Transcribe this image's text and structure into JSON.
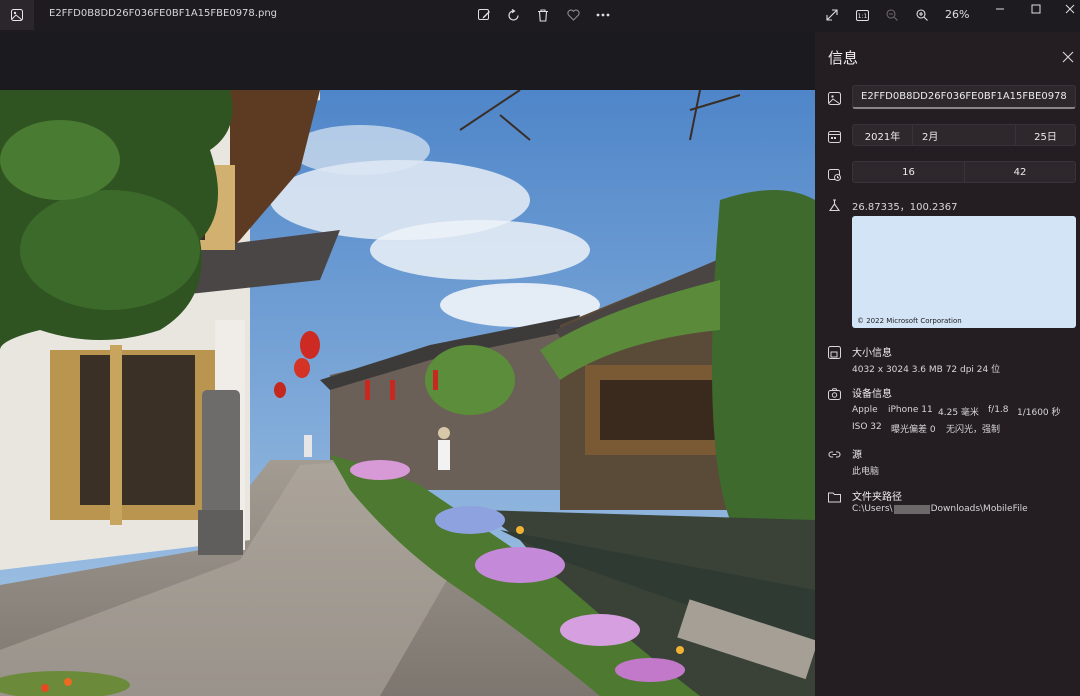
{
  "window": {
    "file_title": "E2FFD0B8DD26F036FE0BF1A15FBE0978.png",
    "zoom": "26%"
  },
  "info_panel": {
    "title": "信息",
    "filename": "E2FFD0B8DD26F036FE0BF1A15FBE0978",
    "date": {
      "year": "2021年",
      "month": "2月",
      "day": "25日"
    },
    "time": {
      "hour": "16",
      "minute": "42"
    },
    "location": "26.87335，100.2367",
    "map_copyright": "© 2022 Microsoft Corporation",
    "size": {
      "heading": "大小信息",
      "details": "4032 x 3024   3.6 MB   72 dpi   24 位"
    },
    "device": {
      "heading": "设备信息",
      "line1": [
        "Apple",
        "iPhone 11",
        "4.25 毫米",
        "f/1.8",
        "1/1600 秒"
      ],
      "line2": [
        "ISO 32",
        "曝光偏差 0",
        "无闪光，强制"
      ]
    },
    "source": {
      "heading": "源",
      "value": "此电脑"
    },
    "folder": {
      "heading": "文件夹路径",
      "prefix": "C:\\Users\\",
      "suffix": "Downloads\\MobileFile"
    }
  },
  "icons": {
    "app": "photos-app-icon",
    "edit": "edit-image-icon",
    "rotate": "rotate-icon",
    "delete": "delete-icon",
    "favorite": "heart-icon",
    "more": "more-icon",
    "fullscreen": "expand-icon",
    "actual_size": "actual-size-icon",
    "zoom_out": "zoom-out-icon",
    "zoom_in": "zoom-in-icon"
  }
}
